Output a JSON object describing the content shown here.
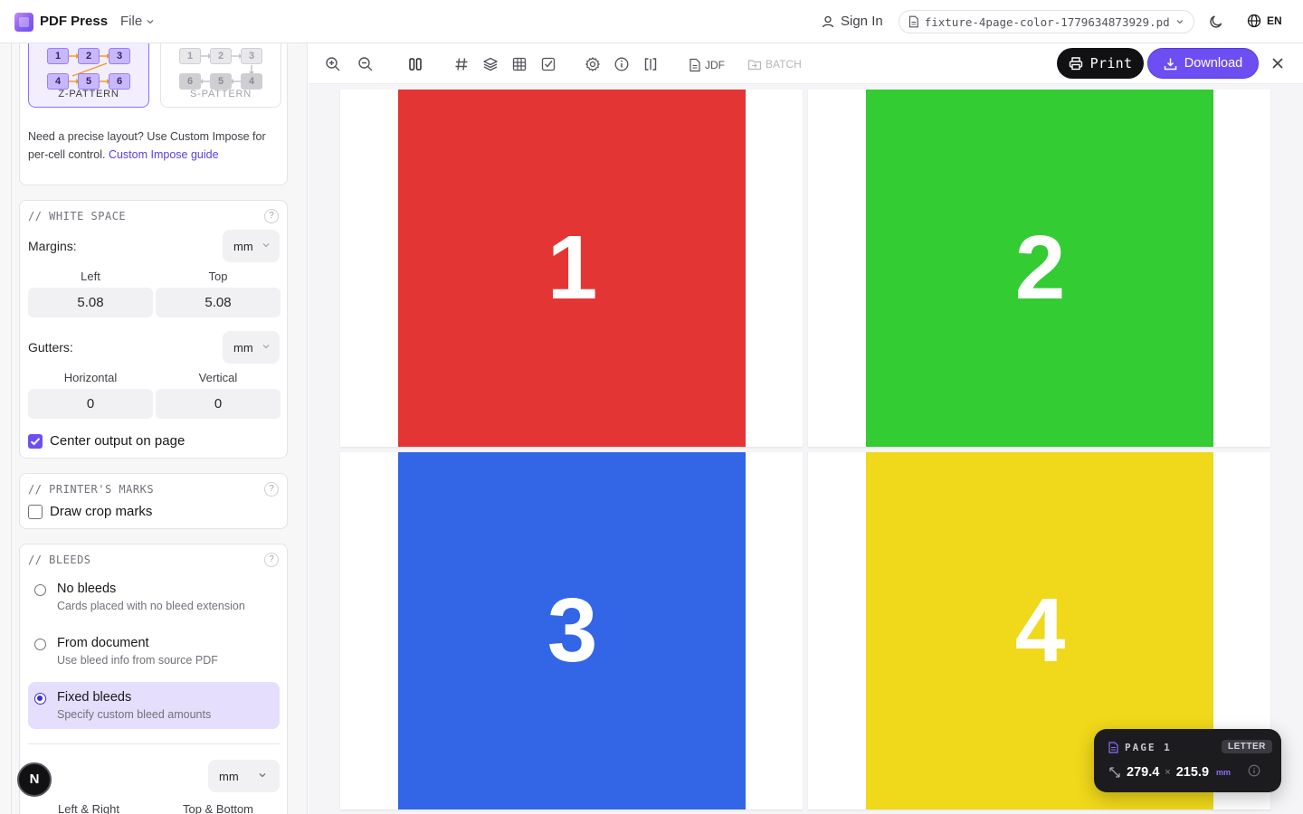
{
  "app": {
    "name": "PDF Press",
    "file_menu": "File"
  },
  "topbar": {
    "sign_in": "Sign In",
    "file_name": "fixture-4page-color-1779634873929.pdf",
    "language": "EN"
  },
  "sidebar": {
    "patterns": [
      {
        "label": "Z-PATTERN",
        "selected": true,
        "cells": [
          "1",
          "2",
          "3",
          "4",
          "5",
          "6"
        ]
      },
      {
        "label": "S-PATTERN",
        "selected": false,
        "cells": [
          "1",
          "2",
          "3",
          "6",
          "5",
          "4"
        ]
      }
    ],
    "custom_impose_note": "Need a precise layout? Use Custom Impose for per-cell control.",
    "custom_impose_link": "Custom Impose guide",
    "white_space": {
      "title": "// WHITE SPACE",
      "help": "?",
      "margins_label": "Margins:",
      "margins_unit": "mm",
      "left_label": "Left",
      "top_label": "Top",
      "left_value": "5.08",
      "top_value": "5.08",
      "gutters_label": "Gutters:",
      "gutters_unit": "mm",
      "horizontal_label": "Horizontal",
      "vertical_label": "Vertical",
      "horizontal_value": "0",
      "vertical_value": "0",
      "center_label": "Center output on page",
      "center_checked": true
    },
    "printers_marks": {
      "title": "// PRINTER'S MARKS",
      "help": "?",
      "crop_label": "Draw crop marks",
      "crop_checked": false
    },
    "bleeds": {
      "title": "// BLEEDS",
      "help": "?",
      "options": [
        {
          "title": "No bleeds",
          "subtitle": "Cards placed with no bleed extension",
          "selected": false
        },
        {
          "title": "From document",
          "subtitle": "Use bleed info from source PDF",
          "selected": false
        },
        {
          "title": "Fixed bleeds",
          "subtitle": "Specify custom bleed amounts",
          "selected": true
        }
      ],
      "unit": "mm",
      "left_right_label": "Left & Right",
      "top_bottom_label": "Top & Bottom"
    },
    "fab_letter": "N"
  },
  "toolbar": {
    "jdf_label": "JDF",
    "batch_label": "BATCH",
    "print_label": "Print",
    "download_label": "Download"
  },
  "canvas": {
    "pages": [
      {
        "number": "1",
        "color": "#e43535"
      },
      {
        "number": "2",
        "color": "#33cc33"
      },
      {
        "number": "3",
        "color": "#3366e6"
      },
      {
        "number": "4",
        "color": "#f0d81a"
      }
    ]
  },
  "page_info": {
    "label": "PAGE 1",
    "size_badge": "LETTER",
    "width": "279.4",
    "height": "215.9",
    "unit": "mm",
    "separator": "×"
  },
  "colors": {
    "accent": "#6d4ef2",
    "print_button": "#111114"
  }
}
